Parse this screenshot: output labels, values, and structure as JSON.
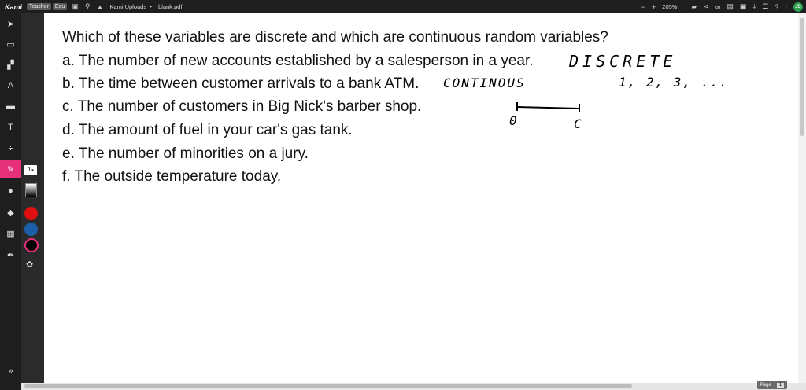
{
  "app": {
    "brand": "Kami",
    "badge_teacher": "Teacher",
    "badge_edu": "Edu",
    "breadcrumb_folder": "Kami Uploads",
    "breadcrumb_file": "blank.pdf",
    "zoom": "205%",
    "avatar": "JS"
  },
  "question": {
    "stem": "Which of these variables are discrete and which are continuous random variables?",
    "items": [
      "a. The number of new accounts established by a salesperson in a year.",
      "b. The time between customer arrivals to a bank ATM.",
      "c. The number of customers in Big Nick's barber shop.",
      "d. The amount of fuel in your car's gas tank.",
      "e. The number of minorities on a jury.",
      "f. The outside temperature today."
    ]
  },
  "handwriting": {
    "discrete": "DISCRETE",
    "continuous": "CONTINOUS",
    "sequence": "1, 2, 3, ...",
    "interval_start": "0",
    "interval_end": "C"
  },
  "tools": {
    "stroke_size": "1",
    "colors": [
      "#e01010",
      "#1a5fa8",
      "#000000"
    ]
  },
  "pager": {
    "label": "Page",
    "current": "1"
  }
}
